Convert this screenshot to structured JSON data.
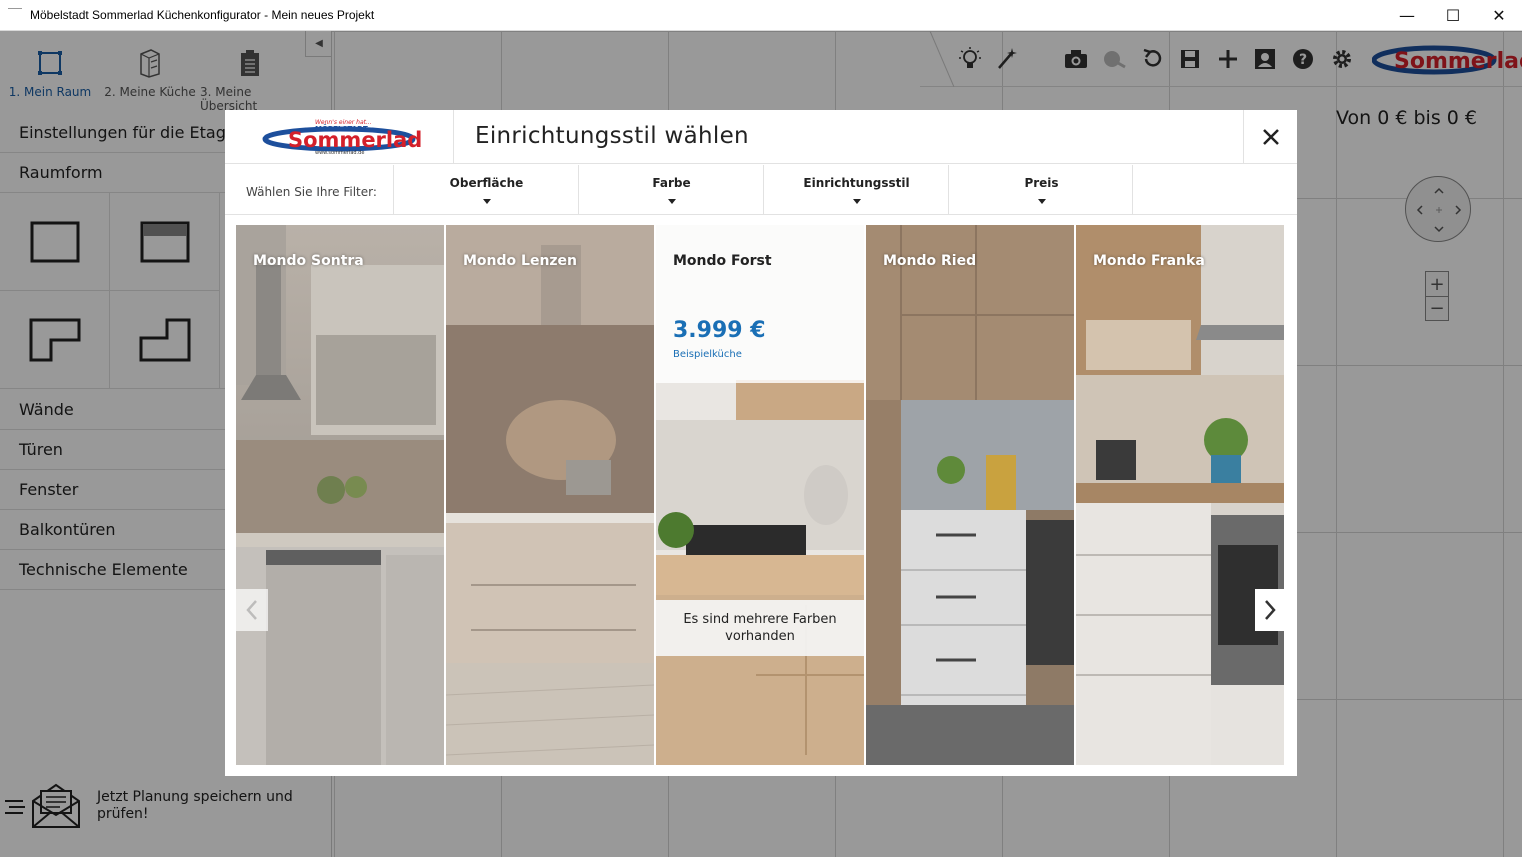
{
  "window": {
    "title": "Möbelstadt Sommerlad Küchenkonfigurator - Mein neues Projekt",
    "minimize": "—",
    "maximize": "☐",
    "close": "✕"
  },
  "steps": [
    {
      "label": "1. Mein Raum",
      "icon": "room-outline-icon"
    },
    {
      "label": "2. Meine Küche",
      "icon": "cabinet-icon"
    },
    {
      "label": "3. Meine Übersicht",
      "icon": "clipboard-icon"
    }
  ],
  "left_menu": {
    "floor_settings": "Einstellungen für die Etage",
    "room_shape": "Raumform",
    "walls": "Wände",
    "doors": "Türen",
    "windows": "Fenster",
    "balcony_doors": "Balkontüren",
    "technical": "Technische Elemente"
  },
  "save_prompt": "Jetzt Planung speichern und prüfen!",
  "price_range": "Von 0 € bis 0 €",
  "logo": {
    "tagline": "Wenn's einer hat...",
    "sub": "MÖBELSTADT",
    "name": "Sommerlad",
    "url": "www.sommerlad.de"
  },
  "modal": {
    "title": "Einrichtungsstil wählen",
    "filter_label": "Wählen Sie Ihre Filter:",
    "filters": [
      "Oberfläche",
      "Farbe",
      "Einrichtungsstil",
      "Preis"
    ],
    "cards": [
      {
        "name": "Mondo Sontra"
      },
      {
        "name": "Mondo Lenzen"
      },
      {
        "name": "Mondo Forst",
        "price": "3.999 €",
        "price_note": "Beispielküche",
        "colors_note": "Es sind mehrere Farben vorhanden"
      },
      {
        "name": "Mondo Ried"
      },
      {
        "name": "Mondo Franka"
      }
    ]
  },
  "colors": {
    "accent_blue": "#1a6fb5",
    "brand_red": "#d4202a",
    "brand_blue": "#1d4f9c"
  }
}
